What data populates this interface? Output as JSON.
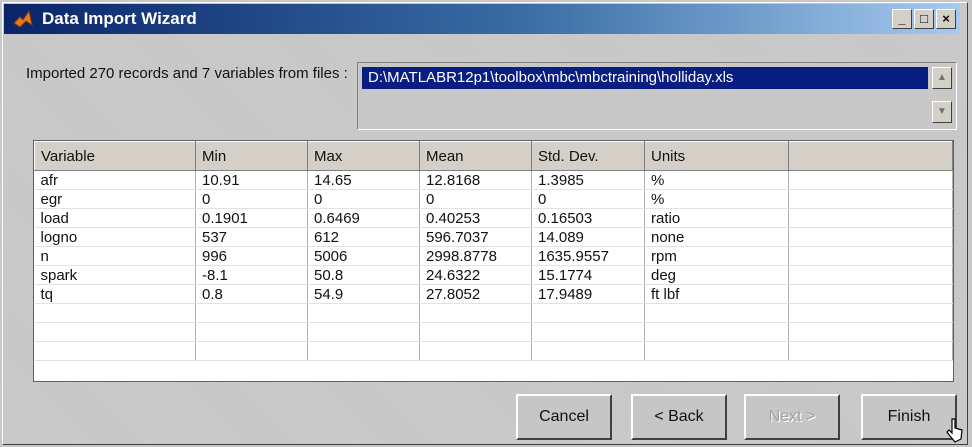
{
  "window": {
    "title": "Data Import Wizard"
  },
  "title_buttons": {
    "minimize": "_",
    "maximize": "□",
    "close": "×"
  },
  "import": {
    "summary": "Imported 270 records and 7 variables from files :",
    "files": [
      "D:\\MATLABR12p1\\toolbox\\mbc\\mbctraining\\holliday.xls"
    ]
  },
  "table": {
    "headers": [
      "Variable",
      "Min",
      "Max",
      "Mean",
      "Std. Dev.",
      "Units",
      ""
    ],
    "rows": [
      [
        "afr",
        "10.91",
        "14.65",
        "12.8168",
        "1.3985",
        "%",
        ""
      ],
      [
        "egr",
        "0",
        "0",
        "0",
        "0",
        "%",
        ""
      ],
      [
        "load",
        "0.1901",
        "0.6469",
        "0.40253",
        "0.16503",
        "ratio",
        ""
      ],
      [
        "logno",
        "537",
        "612",
        "596.7037",
        "14.089",
        "none",
        ""
      ],
      [
        "n",
        "996",
        "5006",
        "2998.8778",
        "1635.9557",
        "rpm",
        ""
      ],
      [
        "spark",
        "-8.1",
        "50.8",
        "24.6322",
        "15.1774",
        "deg",
        ""
      ],
      [
        "tq",
        "0.8",
        "54.9",
        "27.8052",
        "17.9489",
        "ft lbf",
        ""
      ],
      [
        "",
        "",
        "",
        "",
        "",
        "",
        ""
      ],
      [
        "",
        "",
        "",
        "",
        "",
        "",
        ""
      ],
      [
        "",
        "",
        "",
        "",
        "",
        "",
        ""
      ]
    ]
  },
  "buttons": {
    "cancel": "Cancel",
    "back": "< Back",
    "next": "Next >",
    "finish": "Finish"
  },
  "colors": {
    "title_start": "#0a246a",
    "title_end": "#a6caf0",
    "selection": "#0a1e82"
  }
}
